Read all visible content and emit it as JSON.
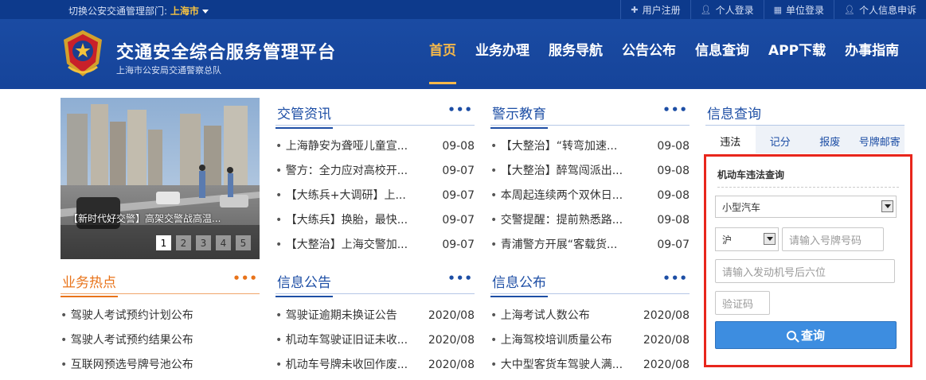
{
  "topbar": {
    "switch_label": "切换公安交通管理部门: ",
    "city": "上海市",
    "links": [
      {
        "icon": "plus-icon",
        "label": "用户注册"
      },
      {
        "icon": "user-icon",
        "label": "个人登录"
      },
      {
        "icon": "building-icon",
        "label": "单位登录"
      },
      {
        "icon": "user-icon",
        "label": "个人信息申诉"
      }
    ]
  },
  "header": {
    "title": "交通安全综合服务管理平台",
    "subtitle": "上海市公安局交通警察总队",
    "nav": [
      "首页",
      "业务办理",
      "服务导航",
      "公告公布",
      "信息查询",
      "APP下载",
      "办事指南"
    ],
    "active_index": 0
  },
  "banner": {
    "caption": "【新时代好交警】高架交警战高温...",
    "pages": [
      "1",
      "2",
      "3",
      "4",
      "5"
    ],
    "active_page": 0
  },
  "news": {
    "title": "交管资讯",
    "more": "•••",
    "items": [
      {
        "text": "上海静安为聋哑儿童宣...",
        "date": "09-08"
      },
      {
        "text": "警方：全力应对高校开...",
        "date": "09-07"
      },
      {
        "text": "【大练兵+大调研】上...",
        "date": "09-07"
      },
      {
        "text": "【大练兵】换胎，最快...",
        "date": "09-07"
      },
      {
        "text": "【大整治】上海交警加...",
        "date": "09-07"
      }
    ]
  },
  "warning": {
    "title": "警示教育",
    "more": "•••",
    "items": [
      {
        "text": "【大整治】“转弯加速...",
        "date": "09-08"
      },
      {
        "text": "【大整治】醉驾闯派出...",
        "date": "09-08"
      },
      {
        "text": "本周起连续两个双休日...",
        "date": "09-08"
      },
      {
        "text": "交警提醒：提前熟悉路...",
        "date": "09-08"
      },
      {
        "text": "青浦警方开展“客载货...",
        "date": "09-07"
      }
    ]
  },
  "hot": {
    "title": "业务热点",
    "more": "•••",
    "items": [
      {
        "text": "驾驶人考试预约计划公布"
      },
      {
        "text": "驾驶人考试预约结果公布"
      },
      {
        "text": "互联网预选号牌号池公布"
      }
    ]
  },
  "notice": {
    "title": "信息公告",
    "more": "•••",
    "items": [
      {
        "text": "驾驶证逾期未换证公告",
        "date": "2020/08"
      },
      {
        "text": "机动车驾驶证旧证未收...",
        "date": "2020/08"
      },
      {
        "text": "机动车号牌未收回作废...",
        "date": "2020/08"
      }
    ]
  },
  "publish": {
    "title": "信息公布",
    "more": "•••",
    "items": [
      {
        "text": "上海考试人数公布",
        "date": "2020/08"
      },
      {
        "text": "上海驾校培训质量公布",
        "date": "2020/08"
      },
      {
        "text": "大中型客货车驾驶人满...",
        "date": "2020/08"
      }
    ]
  },
  "query": {
    "title": "信息查询",
    "tabs": [
      "违法",
      "记分",
      "报废",
      "号牌邮寄"
    ],
    "active_tab": 0,
    "form_title": "机动车违法查询",
    "vehicle_type": "小型汽车",
    "province": "沪",
    "plate_placeholder": "请输入号牌号码",
    "engine_placeholder": "请输入发动机号后六位",
    "captcha_placeholder": "验证码",
    "submit": "查询"
  }
}
